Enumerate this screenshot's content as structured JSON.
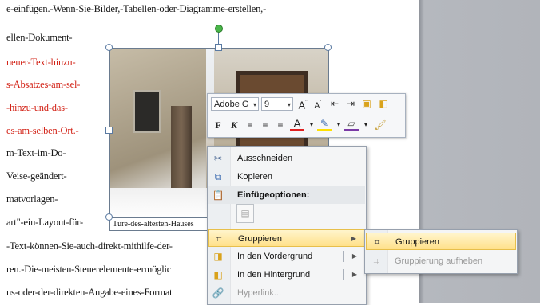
{
  "document": {
    "lines": [
      {
        "text": "e-einfügen.-Wenn-Sie-Bilder,-Tabellen-oder-Diagramme-erstellen,-",
        "color": "#1a1a1a"
      },
      {
        "text": "ellen-Dokument-",
        "color": "#1a1a1a"
      },
      {
        "text": "neuer-Text-hinzu-",
        "color": "#d32418"
      },
      {
        "text": "s-Absatzes-am-sel-",
        "color": "#d32418"
      },
      {
        "text": "-hinzu-und-das-",
        "color": "#d32418"
      },
      {
        "text": "es-am-selben-Ort.-",
        "color": "#d32418"
      },
      {
        "text": "m-Text-im-Do-",
        "color": "#1a1a1a"
      },
      {
        "text": "Veise-geändert-",
        "color": "#1a1a1a"
      },
      {
        "text": "matvorlagen-",
        "color": "#1a1a1a"
      },
      {
        "text": "art\"-ein-Layout-für-",
        "color": "#1a1a1a"
      },
      {
        "text": "-Text-können-Sie-auch-direkt-mithilfe-der-",
        "color": "#1a1a1a"
      },
      {
        "text": "ren.-Die-meisten-Steuerelemente-ermöglic",
        "color": "#1a1a1a"
      },
      {
        "text": "ns-oder-der-direkten-Angabe-eines-Format",
        "color": "#1a1a1a"
      }
    ],
    "caption": "Türe-des-ältesten-Hauses"
  },
  "mini_toolbar": {
    "font_name": "Adobe G",
    "font_size": "9",
    "row1_icons": [
      "grow-font-icon",
      "shrink-font-icon",
      "decrease-indent-icon",
      "increase-indent-icon",
      "format-painter-icon",
      "styles-icon"
    ],
    "row2_icons": [
      "bold-icon",
      "italic-icon",
      "align-left-icon",
      "center-icon",
      "align-right-icon",
      "font-color-icon",
      "highlight-color-icon",
      "shape-fill-icon",
      "shape-outline-icon",
      "format-brush-icon"
    ]
  },
  "context_menu": {
    "items": [
      {
        "label": "Ausschneiden",
        "icon": "scissors-icon"
      },
      {
        "label": "Kopieren",
        "icon": "copy-icon"
      },
      {
        "label": "Einfügeoptionen:",
        "icon": "paste-options-icon"
      },
      {
        "label": "Gruppieren",
        "icon": "group-icon"
      },
      {
        "label": "In den Vordergrund",
        "icon": "bring-forward-icon"
      },
      {
        "label": "In den Hintergrund",
        "icon": "send-backward-icon"
      },
      {
        "label": "Hyperlink...",
        "icon": "hyperlink-icon"
      }
    ]
  },
  "submenu": {
    "items": [
      {
        "label": "Gruppieren",
        "icon": "group-icon"
      },
      {
        "label": "Gruppierung aufheben",
        "icon": "ungroup-icon"
      }
    ]
  },
  "colors": {
    "accent_highlight": "#ffe18a",
    "red_text": "#d32418",
    "font_color_bar": "#e02020",
    "highlight_bar": "#ffe000"
  }
}
